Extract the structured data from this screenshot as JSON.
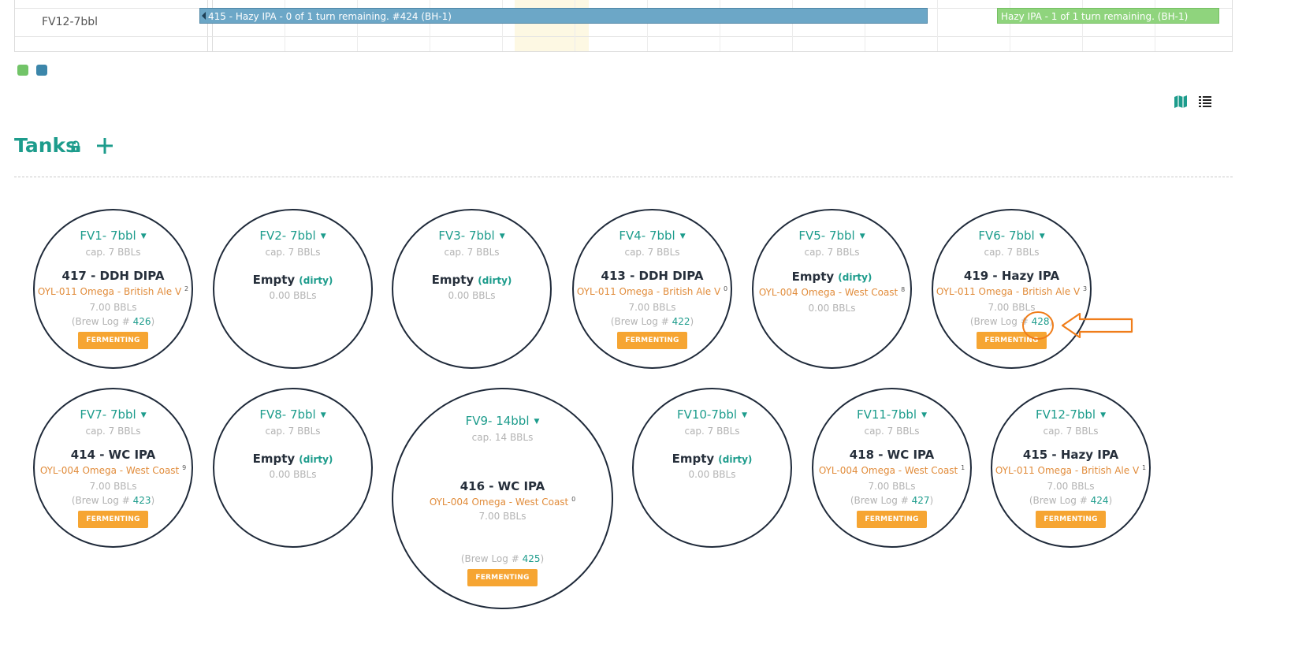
{
  "schedule": {
    "row_label": "FV12-7bbl",
    "bar_blue_text": "415 - Hazy IPA - 0 of 1 turn remaining. #424 (BH-1)",
    "bar_green_text": "Hazy IPA - 1 of 1 turn remaining. (BH-1)",
    "legend_colors": [
      "#72c468",
      "#3c86aa"
    ]
  },
  "icons": {
    "map": "map-icon",
    "list": "list-icon",
    "lock": "lock-icon",
    "add": "plus-icon"
  },
  "tanks_title": "Tanks",
  "accent_color": "#1d9c8c",
  "status_color": "#f6a532",
  "tanks": [
    {
      "name": "FV1- 7bbl",
      "cap": "cap. 7 BBLs",
      "batch": "417 - DDH DIPA",
      "yeast": "OYL-011 Omega - British Ale V",
      "yeast_sup": "2",
      "vol": "7.00 BBLs",
      "log_prefix": "(Brew Log # ",
      "log": "426",
      "log_suffix": ")",
      "status": "FERMENTING"
    },
    {
      "name": "FV2- 7bbl",
      "cap": "cap. 7 BBLs",
      "empty": "Empty",
      "dirty": "(dirty)",
      "vol": "0.00 BBLs"
    },
    {
      "name": "FV3- 7bbl",
      "cap": "cap. 7 BBLs",
      "empty": "Empty",
      "dirty": "(dirty)",
      "vol": "0.00 BBLs"
    },
    {
      "name": "FV4- 7bbl",
      "cap": "cap. 7 BBLs",
      "batch": "413 - DDH DIPA",
      "yeast": "OYL-011 Omega - British Ale V",
      "yeast_sup": "0",
      "vol": "7.00 BBLs",
      "log_prefix": "(Brew Log # ",
      "log": "422",
      "log_suffix": ")",
      "status": "FERMENTING"
    },
    {
      "name": "FV5- 7bbl",
      "cap": "cap. 7 BBLs",
      "empty": "Empty",
      "dirty": "(dirty)",
      "yeast": "OYL-004 Omega - West Coast",
      "yeast_sup": "8",
      "vol": "0.00 BBLs"
    },
    {
      "name": "FV6- 7bbl",
      "cap": "cap. 7 BBLs",
      "batch": "419 - Hazy IPA",
      "yeast": "OYL-011 Omega - British Ale V",
      "yeast_sup": "3",
      "vol": "7.00 BBLs",
      "log_prefix": "(Brew Log # ",
      "log": "428",
      "log_suffix": ")",
      "status": "FERMENTING"
    },
    {
      "name": "FV7- 7bbl",
      "cap": "cap. 7 BBLs",
      "batch": "414 - WC IPA",
      "yeast": "OYL-004 Omega - West Coast",
      "yeast_sup": "9",
      "vol": "7.00 BBLs",
      "log_prefix": "(Brew Log # ",
      "log": "423",
      "log_suffix": ")",
      "status": "FERMENTING"
    },
    {
      "name": "FV8- 7bbl",
      "cap": "cap. 7 BBLs",
      "empty": "Empty",
      "dirty": "(dirty)",
      "vol": "0.00 BBLs"
    },
    {
      "name": "FV9- 14bbl",
      "cap": "cap. 14 BBLs",
      "batch": "416 - WC IPA",
      "yeast": "OYL-004 Omega - West Coast",
      "yeast_sup": "0",
      "vol": "7.00 BBLs",
      "log_prefix": "(Brew Log # ",
      "log": "425",
      "log_suffix": ")",
      "status": "FERMENTING"
    },
    {
      "name": "FV10-7bbl",
      "cap": "cap. 7 BBLs",
      "empty": "Empty",
      "dirty": "(dirty)",
      "vol": "0.00 BBLs"
    },
    {
      "name": "FV11-7bbl",
      "cap": "cap. 7 BBLs",
      "batch": "418 - WC IPA",
      "yeast": "OYL-004 Omega - West Coast",
      "yeast_sup": "1",
      "vol": "7.00 BBLs",
      "log_prefix": "(Brew Log # ",
      "log": "427",
      "log_suffix": ")",
      "status": "FERMENTING"
    },
    {
      "name": "FV12-7bbl",
      "cap": "cap. 7 BBLs",
      "batch": "415 - Hazy IPA",
      "yeast": "OYL-011 Omega - British Ale V",
      "yeast_sup": "1",
      "vol": "7.00 BBLs",
      "log_prefix": "(Brew Log # ",
      "log": "424",
      "log_suffix": ")",
      "status": "FERMENTING"
    }
  ]
}
